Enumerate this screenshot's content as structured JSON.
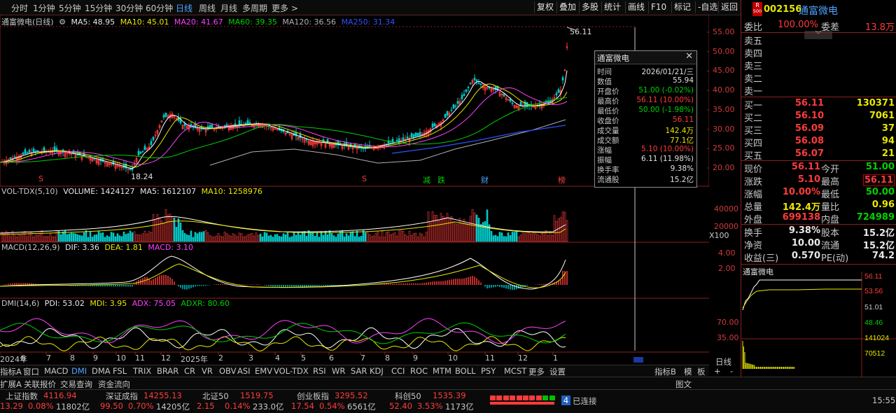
{
  "toolbar": {
    "periods": [
      "分时",
      "1分钟",
      "5分钟",
      "15分钟",
      "30分钟",
      "60分钟",
      "日线",
      "周线",
      "月线",
      "多周期",
      "更多 >"
    ],
    "active_period": "日线",
    "right_buttons": [
      "复权",
      "叠加",
      "多股",
      "统计",
      "画线",
      "F10",
      "标记",
      "-自选",
      "返回"
    ]
  },
  "main_legend": {
    "title": "通富微电(日线)",
    "ma5": "MA5: 48.95",
    "ma10": "MA10: 45.01",
    "ma20": "MA20: 41.67",
    "ma60": "MA60: 39.35",
    "ma120": "MA120: 36.56",
    "ma250": "MA250: 31.34"
  },
  "price_axis": [
    "55.00",
    "50.00",
    "45.00",
    "40.00",
    "35.00",
    "30.00",
    "25.00",
    "20.00"
  ],
  "price_annotations": {
    "high": "56.11",
    "low": "18.24"
  },
  "event_markers": [
    "S",
    "S",
    "减",
    "跌",
    "财",
    "榜"
  ],
  "volume_legend": {
    "name": "VOL-TDX(5,10)",
    "volume": "VOLUME: 1424127",
    "ma5": "MA5: 1612107",
    "ma10": "MA10: 1258976"
  },
  "volume_axis": [
    "40000",
    "20000"
  ],
  "volume_unit": "X100",
  "macd_legend": {
    "name": "MACD(12,26,9)",
    "dif": "DIF: 3.36",
    "dea": "DEA: 1.81",
    "macd": "MACD: 3.10"
  },
  "macd_axis": [
    "4.00",
    "2.00"
  ],
  "dmi_legend": {
    "name": "DMI(14,6)",
    "pdi": "PDI: 53.02",
    "mdi": "MDI: 3.95",
    "adx": "ADX: 75.05",
    "adxr": "ADXR: 80.60"
  },
  "dmi_axis": [
    "70.00",
    "35.00"
  ],
  "time_axis": [
    "2024年",
    "6",
    "7",
    "8",
    "9",
    "10",
    "11",
    "12",
    "2025年",
    "2",
    "3",
    "4",
    "5",
    "6",
    "7",
    "8",
    "9",
    "10",
    "11",
    "12",
    "1"
  ],
  "popup": {
    "title": "通富微电",
    "rows": [
      {
        "k": "时间",
        "v": "2026/01/21/三",
        "c": "white"
      },
      {
        "k": "数值",
        "v": "55.94",
        "c": "white"
      },
      {
        "k": "开盘价",
        "v": "51.00 (-0.02%)",
        "c": "green"
      },
      {
        "k": "最高价",
        "v": "56.11 (10.00%)",
        "c": "red"
      },
      {
        "k": "最低价",
        "v": "50.00 (-1.98%)",
        "c": "green"
      },
      {
        "k": "收盘价",
        "v": "56.11",
        "c": "red"
      },
      {
        "k": "成交量",
        "v": "142.4万",
        "c": "yellow"
      },
      {
        "k": "成交额",
        "v": "77.1亿",
        "c": "yellow"
      },
      {
        "k": "涨幅",
        "v": "5.10 (10.00%)",
        "c": "red"
      },
      {
        "k": "振幅",
        "v": "6.11 (11.98%)",
        "c": "white"
      },
      {
        "k": "换手率",
        "v": "9.38%",
        "c": "white"
      },
      {
        "k": "流通股",
        "v": "15.2亿",
        "c": "white"
      }
    ]
  },
  "indicator_tabs": [
    "指标A",
    "窗口",
    "MACD",
    "DMI",
    "DMA",
    "FSL",
    "TRIX",
    "BRAR",
    "CR",
    "VR",
    "OBV",
    "ASI",
    "EMV",
    "VOL-TDX",
    "RSI",
    "WR",
    "SAR",
    "KDJ",
    "CCI",
    "ROC",
    "MTM",
    "BOLL",
    "PSY",
    "MCST",
    "更多",
    "设置"
  ],
  "active_indicator": "DMI",
  "indicator_right_tabs": [
    "指标B",
    "模",
    "板",
    "+",
    "-"
  ],
  "sub_tabs": [
    "扩展A",
    "关联报价",
    "交易查询",
    "资金流向"
  ],
  "right_sub_tabs": [
    "日线",
    "图文"
  ],
  "status": {
    "indices": [
      {
        "name": "上证指数",
        "value": "4116.94",
        "chg": "13.29",
        "pct": "0.08%",
        "amt": "11802亿"
      },
      {
        "name": "深证成指",
        "value": "14255.13",
        "chg": "99.50",
        "pct": "0.70%",
        "amt": "14205亿"
      },
      {
        "name": "北证50",
        "value": "1519.75",
        "chg": "2.15",
        "pct": "0.14%",
        "amt": "233.0亿"
      },
      {
        "name": "创业板指",
        "value": "3295.52",
        "chg": "17.54",
        "pct": "0.54%",
        "amt": "6561亿"
      },
      {
        "name": "科创50",
        "value": "1535.39",
        "chg": "52.40",
        "pct": "3.53%",
        "amt": "1173亿"
      }
    ],
    "conn_num": "4",
    "conn_text": "已连接",
    "time": "15:55"
  },
  "quote": {
    "badge_top": "R",
    "badge_bottom": "500",
    "code": "002156",
    "name": "通富微电",
    "weibi_label": "委比",
    "weibi_value": "100.00%",
    "weicha_label": "委差",
    "weicha_value": "13.8万",
    "sell": [
      {
        "label": "卖五",
        "price": "",
        "vol": ""
      },
      {
        "label": "卖四",
        "price": "",
        "vol": ""
      },
      {
        "label": "卖三",
        "price": "",
        "vol": ""
      },
      {
        "label": "卖二",
        "price": "",
        "vol": ""
      },
      {
        "label": "卖一",
        "price": "",
        "vol": ""
      }
    ],
    "buy": [
      {
        "label": "买一",
        "price": "56.11",
        "vol": "130371"
      },
      {
        "label": "买二",
        "price": "56.10",
        "vol": "7061"
      },
      {
        "label": "买三",
        "price": "56.09",
        "vol": "37"
      },
      {
        "label": "买四",
        "price": "56.08",
        "vol": "94"
      },
      {
        "label": "买五",
        "price": "56.07",
        "vol": "21"
      }
    ],
    "stats": [
      {
        "l1": "现价",
        "v1": "56.11",
        "c1": "red",
        "l2": "今开",
        "v2": "51.00",
        "c2": "green"
      },
      {
        "l1": "涨跌",
        "v1": "5.10",
        "c1": "red",
        "l2": "最高",
        "v2": "56.11",
        "c2": "red"
      },
      {
        "l1": "涨幅",
        "v1": "10.00%",
        "c1": "red",
        "l2": "最低",
        "v2": "50.00",
        "c2": "green"
      },
      {
        "l1": "总量",
        "v1": "142.4万",
        "c1": "yellow",
        "l2": "量比",
        "v2": "0.96",
        "c2": "yellow"
      },
      {
        "l1": "外盘",
        "v1": "699138",
        "c1": "red",
        "l2": "内盘",
        "v2": "724989",
        "c2": "green"
      }
    ],
    "stats2": [
      {
        "l1": "换手",
        "v1": "9.38%",
        "l2": "股本",
        "v2": "15.2亿"
      },
      {
        "l1": "净资",
        "v1": "10.00",
        "l2": "流通",
        "v2": "15.2亿"
      },
      {
        "l1": "收益(三)",
        "v1": "0.570",
        "l2": "PE(动)",
        "v2": "74.2"
      }
    ],
    "mini_title": "通富微电",
    "mini_price_axis": [
      "56.11",
      "53.56",
      "51.01",
      "48.46"
    ],
    "mini_vol_axis": [
      "141024",
      "70512"
    ]
  },
  "colors": {
    "up": "#ff3b3b",
    "down": "#00d000",
    "ma5": "#ffffff",
    "ma10": "#e8e800",
    "ma20": "#ff40ff",
    "ma60": "#00d000",
    "ma120": "#b0b0b0",
    "ma250": "#3050ff",
    "accent": "#4fa3ff"
  }
}
